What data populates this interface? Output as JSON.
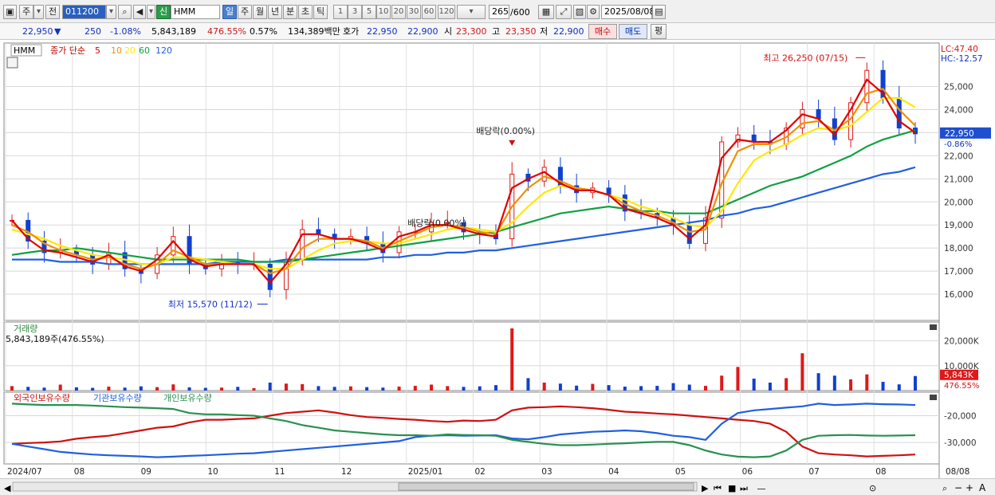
{
  "toolbar": {
    "period_label": "주",
    "prev_label": "전",
    "stock_code": "011200",
    "badge_new": "신",
    "stock_name": "HMM",
    "period_tabs": [
      "일",
      "주",
      "월",
      "년",
      "분",
      "초",
      "틱"
    ],
    "interval_tabs": [
      "1",
      "3",
      "5",
      "10",
      "20",
      "30",
      "60",
      "120"
    ],
    "count_value": "265",
    "count_total": "/600",
    "date_value": "2025/08/08"
  },
  "quote": {
    "price": "22,950",
    "change": "250",
    "change_pct": "-1.08%",
    "volume": "5,843,189",
    "volume_ratio": "476.55%",
    "turnover": "0.57%",
    "amount": "134,389백만",
    "ask_label": "호가",
    "ask": "22,950",
    "bid": "22,900",
    "open_label": "시",
    "open": "23,300",
    "high_label": "고",
    "high": "23,350",
    "low_label": "저",
    "low": "22,900",
    "buy_label": "매수",
    "sell_label": "매도",
    "eval_label": "평"
  },
  "price_panel": {
    "code_tag": "HMM",
    "legend_prefix": "종가 단순",
    "ma_periods": [
      "5",
      "10",
      "20",
      "60",
      "120"
    ],
    "ma_colors": [
      "#e00000",
      "#f09000",
      "#ffe800",
      "#10a040",
      "#2060e0"
    ],
    "lc_label": "LC:47.40",
    "hc_label": "HC:-12.57",
    "current_price_tag": "22,950",
    "current_change_tag": "-0.86%",
    "annot_high": "최고 26,250 (07/15)",
    "annot_low": "최저 15,570 (11/12)",
    "annot_div1": "배당락(0.00%)",
    "annot_div2": "배당락(0.00%)"
  },
  "volume_panel": {
    "title": "거래량",
    "info": "5,843,189주(476.55%)",
    "current_tag": "5,843K",
    "current_pct": "476.55%"
  },
  "holding_panel": {
    "legend": [
      "외국인보유수량",
      "기관보유수량",
      "개인보유수량"
    ],
    "colors": [
      "#d01010",
      "#2060e0",
      "#2a9050"
    ]
  },
  "x_axis": {
    "labels": [
      "2024/07",
      "08",
      "09",
      "10",
      "11",
      "12",
      "2025/01",
      "02",
      "03",
      "04",
      "05",
      "06",
      "07",
      "08"
    ],
    "right_label": "08/08"
  },
  "chart_data": [
    {
      "type": "line",
      "title": "HMM",
      "subtitle": "종가 단순 5 10 20 60 120",
      "y_ticks": [
        16000,
        17000,
        18000,
        19000,
        20000,
        21000,
        22000,
        23000,
        24000,
        25000
      ],
      "ylim": [
        15000,
        26400
      ],
      "x_months": [
        "2024/07",
        "08",
        "09",
        "10",
        "11",
        "12",
        "2025/01",
        "02",
        "03",
        "04",
        "05",
        "06",
        "07",
        "08"
      ],
      "close": [
        19200,
        18300,
        17800,
        17900,
        17700,
        17300,
        17800,
        17100,
        16900,
        17700,
        18500,
        17300,
        17100,
        17400,
        17300,
        17300,
        16200,
        17500,
        18800,
        18600,
        18400,
        18500,
        18200,
        17800,
        18700,
        18700,
        19100,
        19100,
        18700,
        18600,
        18400,
        21200,
        20900,
        21500,
        20700,
        20400,
        20600,
        20300,
        19600,
        19500,
        19300,
        19000,
        18200,
        19300,
        22600,
        22900,
        22600,
        22500,
        23200,
        24000,
        23600,
        22700,
        24300,
        25700,
        24500,
        23200,
        22950
      ],
      "series": [
        {
          "name": "5",
          "values": [
            19200,
            18400,
            17900,
            17800,
            17600,
            17400,
            17700,
            17200,
            17000,
            17500,
            18300,
            17500,
            17200,
            17300,
            17300,
            17300,
            16500,
            17300,
            18600,
            18600,
            18400,
            18400,
            18200,
            17900,
            18500,
            18700,
            19000,
            19000,
            18800,
            18600,
            18500,
            20600,
            21000,
            21300,
            20800,
            20500,
            20500,
            20300,
            19700,
            19500,
            19300,
            19000,
            18400,
            19000,
            21900,
            22700,
            22600,
            22600,
            23100,
            23800,
            23600,
            22900,
            24000,
            25300,
            24700,
            23500,
            23000
          ]
        },
        {
          "name": "10",
          "values": [
            19000,
            18700,
            18200,
            17900,
            17700,
            17500,
            17600,
            17300,
            17100,
            17300,
            17900,
            17600,
            17300,
            17300,
            17300,
            17300,
            16900,
            17100,
            18000,
            18400,
            18400,
            18400,
            18300,
            18000,
            18300,
            18600,
            18900,
            19000,
            18900,
            18700,
            18600,
            19800,
            20600,
            21100,
            20900,
            20600,
            20500,
            20300,
            19900,
            19600,
            19400,
            19100,
            18700,
            18800,
            20800,
            22200,
            22500,
            22500,
            22800,
            23400,
            23500,
            23100,
            23600,
            24700,
            24900,
            24000,
            23300
          ]
        },
        {
          "name": "20",
          "values": [
            18800,
            18600,
            18400,
            18100,
            17900,
            17700,
            17600,
            17500,
            17300,
            17300,
            17600,
            17600,
            17500,
            17400,
            17300,
            17300,
            17100,
            17100,
            17500,
            17900,
            18200,
            18300,
            18300,
            18200,
            18200,
            18400,
            18600,
            18800,
            18900,
            18800,
            18700,
            19100,
            19800,
            20400,
            20700,
            20600,
            20500,
            20300,
            20100,
            19800,
            19600,
            19300,
            19000,
            18900,
            19600,
            20800,
            21800,
            22200,
            22500,
            22900,
            23200,
            23100,
            23300,
            23900,
            24500,
            24500,
            24100
          ]
        },
        {
          "name": "60",
          "values": [
            17700,
            17800,
            17900,
            17900,
            18000,
            17900,
            17800,
            17700,
            17600,
            17500,
            17500,
            17500,
            17500,
            17500,
            17500,
            17400,
            17400,
            17400,
            17500,
            17600,
            17700,
            17800,
            17900,
            18000,
            18100,
            18200,
            18300,
            18400,
            18500,
            18600,
            18700,
            18900,
            19100,
            19300,
            19500,
            19600,
            19700,
            19800,
            19700,
            19600,
            19600,
            19500,
            19500,
            19500,
            19800,
            20100,
            20400,
            20700,
            20900,
            21100,
            21400,
            21700,
            22000,
            22400,
            22700,
            22900,
            23100
          ]
        },
        {
          "name": "120",
          "values": [
            17500,
            17500,
            17500,
            17400,
            17400,
            17400,
            17300,
            17300,
            17300,
            17300,
            17300,
            17300,
            17300,
            17400,
            17400,
            17400,
            17400,
            17500,
            17500,
            17500,
            17500,
            17500,
            17500,
            17600,
            17600,
            17700,
            17700,
            17800,
            17800,
            17900,
            17900,
            18000,
            18100,
            18200,
            18300,
            18400,
            18500,
            18600,
            18700,
            18800,
            18900,
            19000,
            19100,
            19200,
            19400,
            19500,
            19700,
            19800,
            20000,
            20200,
            20400,
            20600,
            20800,
            21000,
            21200,
            21300,
            21500
          ]
        }
      ]
    },
    {
      "type": "bar",
      "title": "거래량",
      "y_ticks": [
        10000,
        20000
      ],
      "ylim": [
        0,
        25000
      ],
      "values": [
        1800,
        1500,
        1200,
        2400,
        1300,
        1100,
        1600,
        1200,
        1700,
        1400,
        2500,
        1300,
        1100,
        1200,
        1500,
        1000,
        3200,
        2800,
        2600,
        1800,
        1500,
        1700,
        1400,
        1200,
        1600,
        1900,
        2400,
        1800,
        1500,
        1700,
        2200,
        25000,
        5000,
        3200,
        2800,
        2000,
        2700,
        2200,
        1600,
        1800,
        1900,
        3000,
        2400,
        1900,
        6000,
        9500,
        4800,
        3200,
        5000,
        15000,
        7000,
        6000,
        4500,
        6500,
        3500,
        2500,
        5843
      ]
    },
    {
      "type": "line",
      "title": "외국인보유수량 기관보유수량 개인보유수량",
      "y_ticks": [
        -30000,
        -20000
      ],
      "ylim": [
        -38000,
        -13000
      ],
      "series": [
        {
          "name": "외국인보유수량",
          "values": [
            -30500,
            -30200,
            -30000,
            -29600,
            -28600,
            -28000,
            -27500,
            -26500,
            -25500,
            -24500,
            -24000,
            -22500,
            -21500,
            -21500,
            -21200,
            -21000,
            -20000,
            -19000,
            -18500,
            -18000,
            -18800,
            -19800,
            -20500,
            -20800,
            -21200,
            -21500,
            -22000,
            -22300,
            -21800,
            -22000,
            -21500,
            -18000,
            -17000,
            -16800,
            -16500,
            -16800,
            -17200,
            -17800,
            -18500,
            -18800,
            -19200,
            -19500,
            -20000,
            -20500,
            -21000,
            -21500,
            -22000,
            -23000,
            -26000,
            -31500,
            -34000,
            -34500,
            -34800,
            -35200,
            -35000,
            -34800,
            -34500
          ]
        },
        {
          "name": "기관보유수량",
          "values": [
            -30500,
            -31500,
            -32500,
            -33500,
            -34000,
            -34500,
            -34800,
            -35000,
            -35200,
            -35500,
            -35300,
            -35000,
            -34800,
            -34500,
            -34200,
            -34000,
            -33500,
            -33000,
            -32500,
            -32000,
            -31500,
            -31000,
            -30500,
            -30000,
            -29500,
            -28000,
            -27500,
            -27300,
            -27500,
            -27400,
            -27300,
            -28500,
            -28800,
            -28000,
            -27000,
            -26500,
            -26000,
            -25800,
            -25500,
            -25800,
            -26500,
            -27500,
            -28000,
            -29000,
            -23000,
            -19000,
            -18000,
            -17500,
            -17000,
            -16500,
            -15500,
            -16000,
            -15800,
            -15500,
            -15700,
            -15800,
            -16000
          ]
        },
        {
          "name": "개인보유수량",
          "values": [
            -15500,
            -15800,
            -16000,
            -16000,
            -16000,
            -16200,
            -16500,
            -16800,
            -17000,
            -17200,
            -17500,
            -19000,
            -19500,
            -19500,
            -19800,
            -20000,
            -21000,
            -22000,
            -23500,
            -24500,
            -25500,
            -26000,
            -26500,
            -27000,
            -27300,
            -27300,
            -27500,
            -27000,
            -27200,
            -27300,
            -27500,
            -29000,
            -29800,
            -30500,
            -31000,
            -31000,
            -30800,
            -30500,
            -30300,
            -30000,
            -29800,
            -29800,
            -31000,
            -33000,
            -34500,
            -35300,
            -35500,
            -35200,
            -33000,
            -29000,
            -27500,
            -27300,
            -27200,
            -27400,
            -27500,
            -27400,
            -27300
          ]
        }
      ]
    }
  ]
}
